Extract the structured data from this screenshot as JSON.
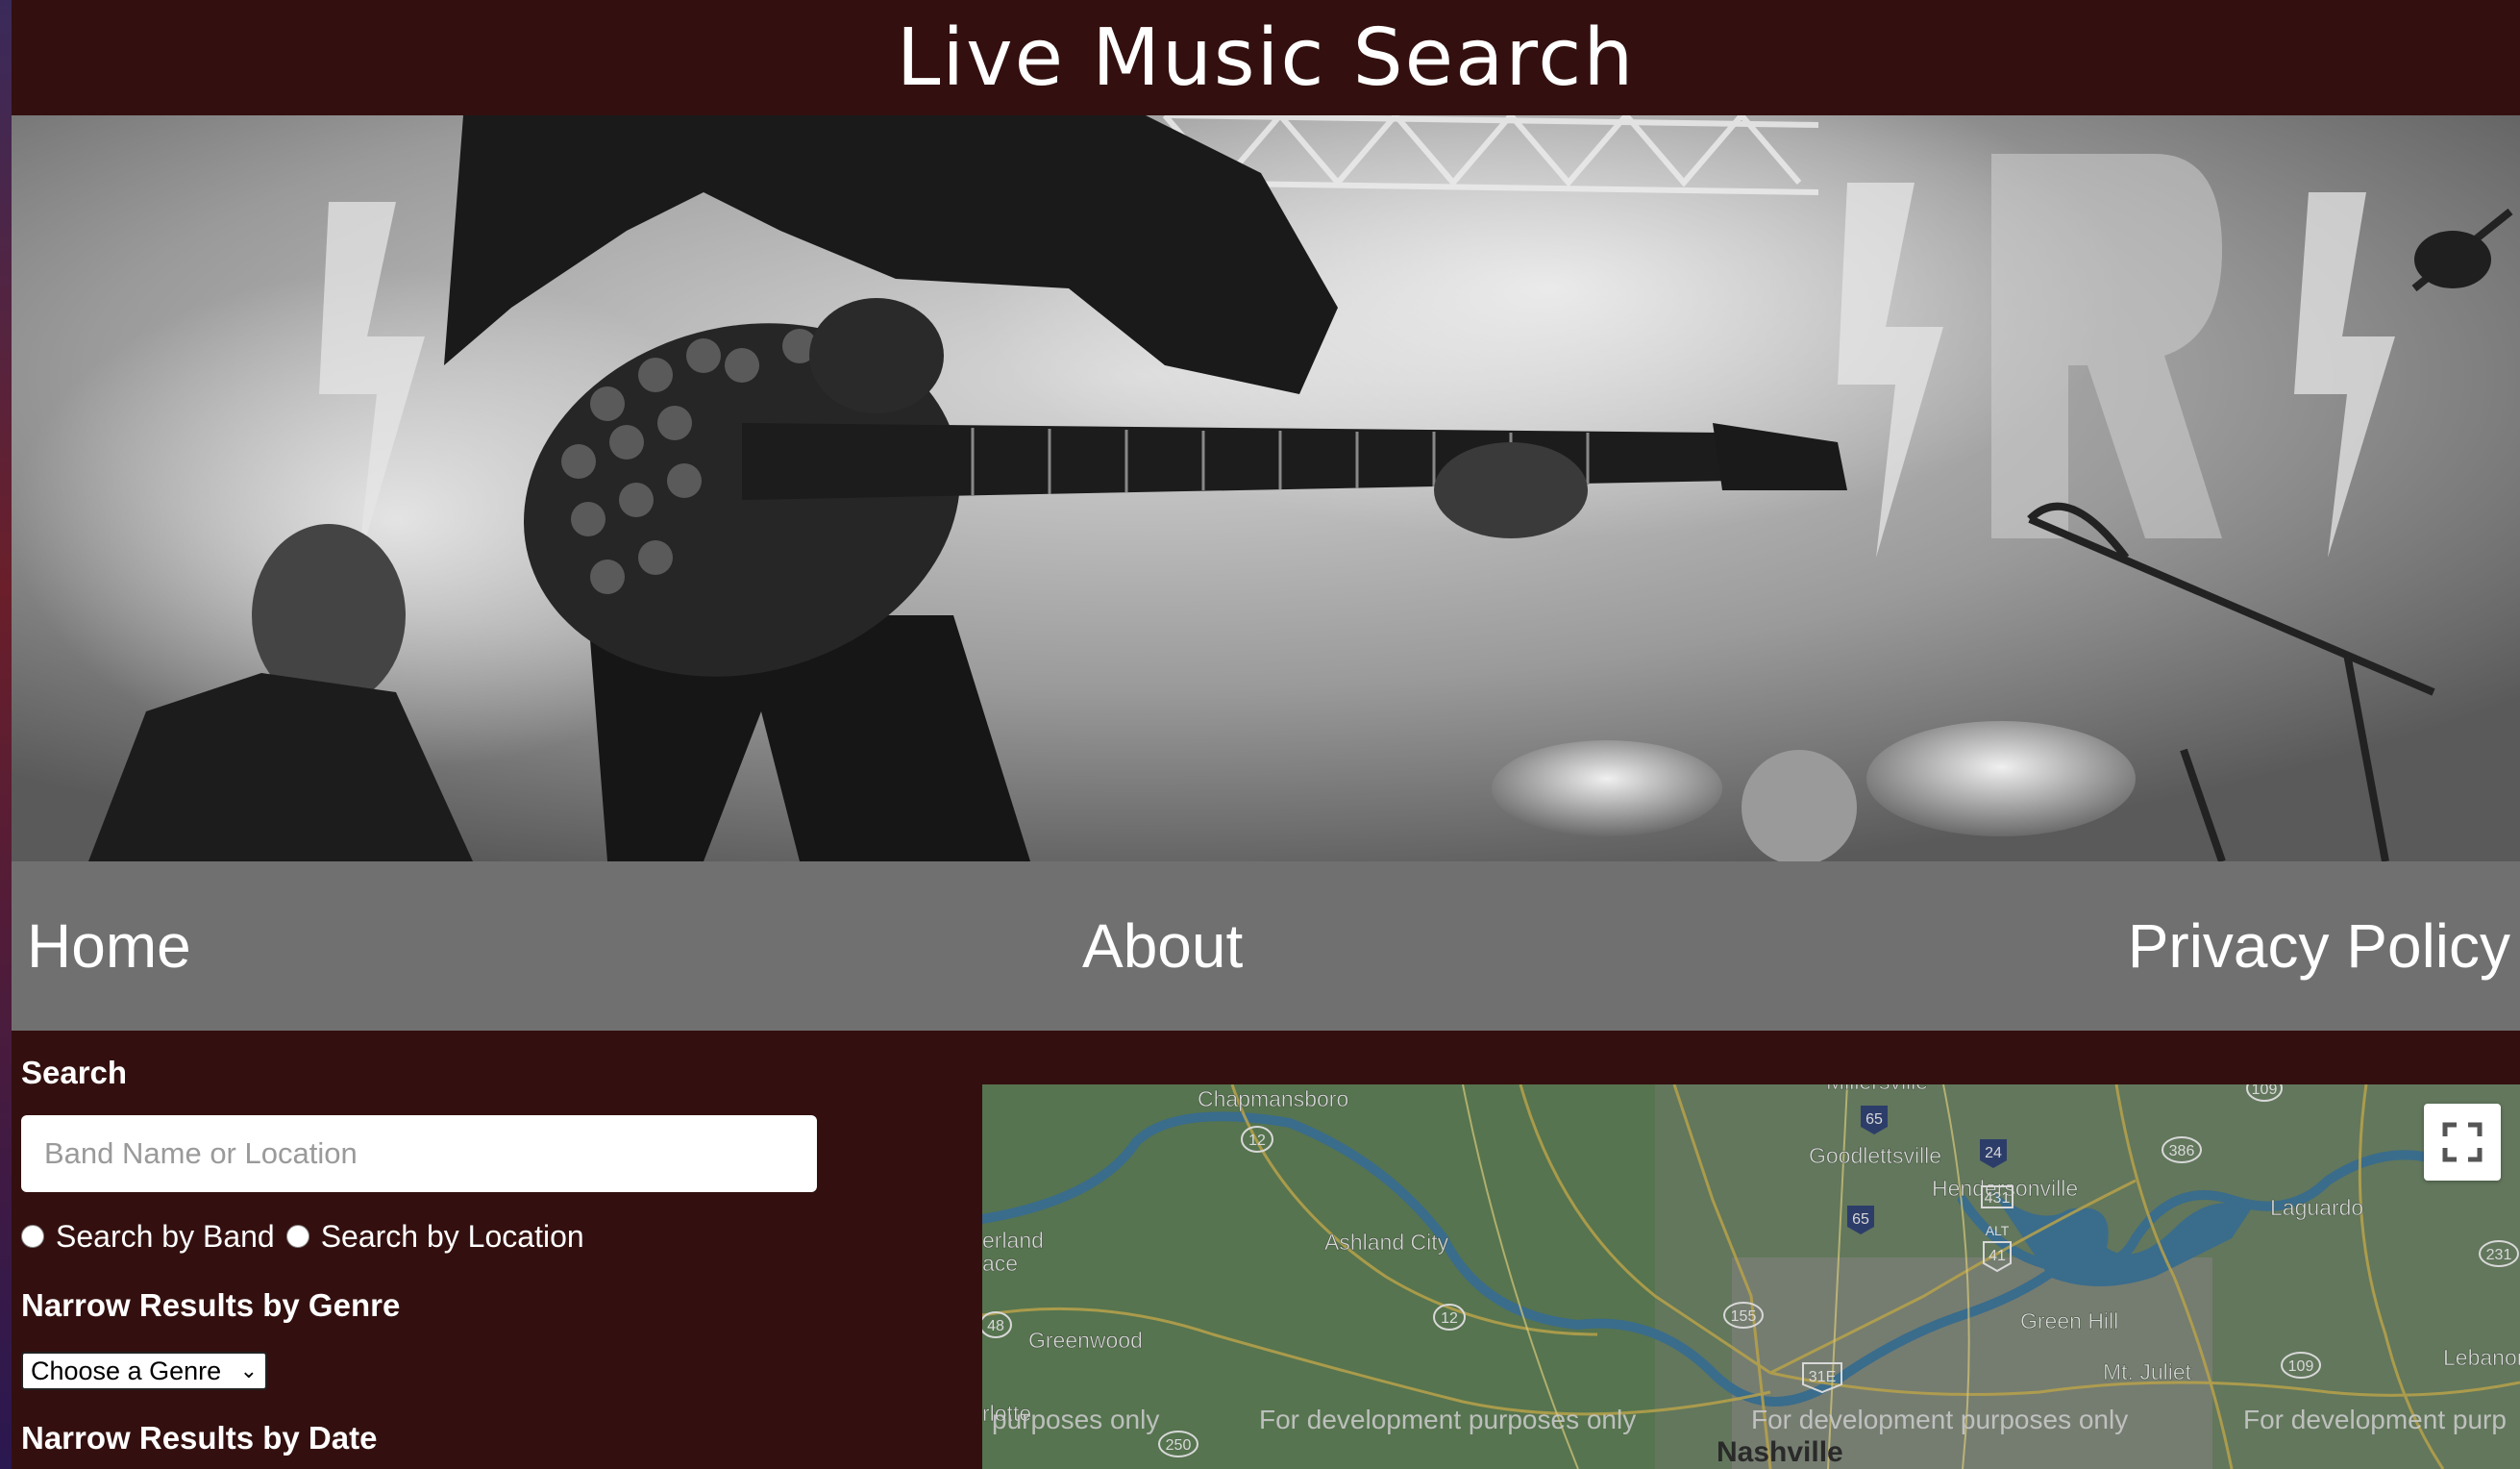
{
  "header": {
    "title": "Live Music Search"
  },
  "nav": {
    "home": "Home",
    "about": "About",
    "privacy": "Privacy Policy"
  },
  "search": {
    "label": "Search",
    "placeholder": "Band Name or Location",
    "radio_band": "Search by Band",
    "radio_location": "Search by Location"
  },
  "filters": {
    "genre_label": "Narrow Results by Genre",
    "genre_selected": "Choose a Genre",
    "date_label": "Narrow Results by Date"
  },
  "map": {
    "places": [
      {
        "name": "Chapmansboro"
      },
      {
        "name": "Millersville"
      },
      {
        "name": "Goodlettsville"
      },
      {
        "name": "Hendersonville"
      },
      {
        "name": "Laguardo"
      },
      {
        "name": "erland"
      },
      {
        "name": "ace"
      },
      {
        "name": "Ashland City"
      },
      {
        "name": "Greenwood"
      },
      {
        "name": "Green Hill"
      },
      {
        "name": "Mt. Juliet"
      },
      {
        "name": "Lebanon"
      },
      {
        "name": "Nashville"
      }
    ],
    "routes": [
      "12",
      "65",
      "24",
      "386",
      "109",
      "431",
      "ALT",
      "41",
      "65",
      "231",
      "48",
      "12",
      "155",
      "31E",
      "109",
      "250"
    ],
    "watermark": [
      "purposes only",
      "For development purposes only",
      "For development purposes only",
      "For development purp"
    ],
    "stray_text": "rlotte",
    "fullscreen_icon": "expand-icon"
  }
}
